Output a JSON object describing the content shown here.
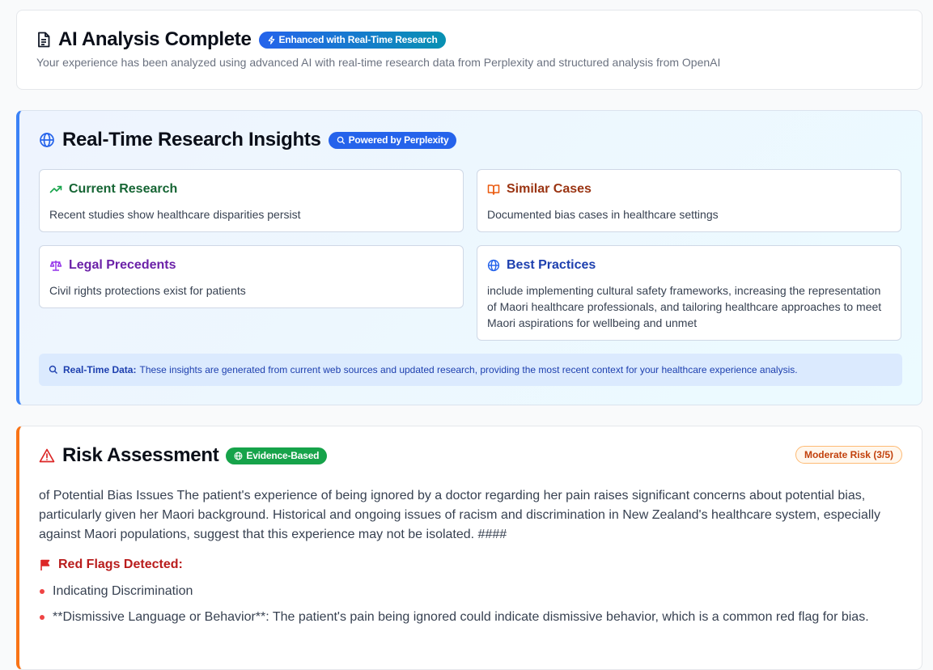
{
  "analysis": {
    "title": "AI Analysis Complete",
    "badge": "Enhanced with Real-Time Research",
    "subtitle": "Your experience has been analyzed using advanced AI with real-time research data from Perplexity and structured analysis from OpenAI",
    "icon": "document-icon"
  },
  "research": {
    "title": "Real-Time Research Insights",
    "badge": "Powered by Perplexity",
    "icon": "globe-icon",
    "accent": "#3b82f6",
    "tiles": [
      {
        "icon": "trending-up-icon",
        "title": "Current Research",
        "body": "Recent studies show healthcare disparities persist",
        "color": "#166534"
      },
      {
        "icon": "book-open-icon",
        "title": "Similar Cases",
        "body": "Documented bias cases in healthcare settings",
        "color": "#9a3412"
      },
      {
        "icon": "scale-icon",
        "title": "Legal Precedents",
        "body": "Civil rights protections exist for patients",
        "color": "#6b21a8"
      },
      {
        "icon": "globe-icon",
        "title": "Best Practices",
        "body": "include implementing cultural safety frameworks, increasing the representation of Maori healthcare professionals, and tailoring healthcare approaches to meet Maori aspirations for wellbeing and unmet",
        "color": "#1e40af"
      }
    ],
    "note_label": "Real-Time Data:",
    "note_text": "These insights are generated from current web sources and updated research, providing the most recent context for your healthcare experience analysis."
  },
  "risk": {
    "title": "Risk Assessment",
    "badge": "Evidence-Based",
    "level_label": "Moderate Risk (3/5)",
    "icon": "warning-triangle-icon",
    "accent": "#f97316",
    "summary": "of Potential Bias Issues The patient's experience of being ignored by a doctor regarding her pain raises significant concerns about potential bias, particularly given her Maori background. Historical and ongoing issues of racism and discrimination in New Zealand's healthcare system, especially against Maori populations, suggest that this experience may not be isolated. ####",
    "flags_title": "Red Flags Detected:",
    "flags": [
      "Indicating Discrimination",
      "**Dismissive Language or Behavior**: The patient's pain being ignored could indicate dismissive behavior, which is a common red flag for bias."
    ]
  }
}
